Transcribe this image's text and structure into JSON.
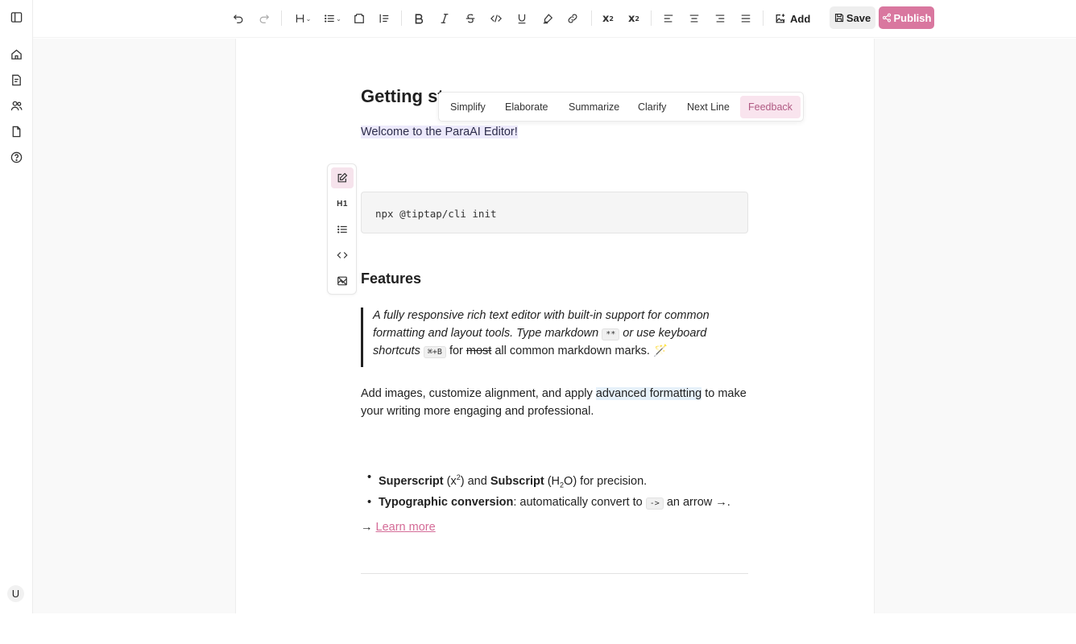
{
  "toolbar": {
    "add_label": "Add",
    "save_label": "Save",
    "publish_label": "Publish",
    "superscript_base": "x",
    "superscript_mark": "2",
    "subscript_base": "x",
    "subscript_mark": "2",
    "colors": {
      "publish_bg": "#d9779f",
      "save_bg": "#eeeeee"
    }
  },
  "rail": {
    "avatar_letter": "U"
  },
  "document": {
    "heading": "Getting st",
    "welcome": "Welcome to the ParaAI Editor!",
    "code": "npx @tiptap/cli init",
    "features_heading": "Features",
    "quote": {
      "part1": "A fully responsive rich text editor with built-in support for common formatting and layout tools. Type markdown ",
      "kbd1": "**",
      "part2": " or use keyboard shortcuts ",
      "kbd2": "⌘+B",
      "part3": " for ",
      "strike": "most",
      "part4": " all common markdown marks. 🪄"
    },
    "paragraph": {
      "before": "Add images, customize alignment, and apply ",
      "highlight": "advanced formatting",
      "after": " to make your writing more engaging and professional."
    },
    "bullets": {
      "b1_bold1": "Superscript",
      "b1_t1": " (x",
      "b1_sup": "2",
      "b1_t2": ") and ",
      "b1_bold2": "Subscript",
      "b1_t3": " (H",
      "b1_sub": "2",
      "b1_t4": "O) for precision.",
      "b2_bold": "Typographic conversion",
      "b2_t1": ": automatically convert to ",
      "b2_kbd": "->",
      "b2_t2": " an arrow →."
    },
    "learn_prefix": "→ ",
    "learn_link": "Learn more"
  },
  "palette": {
    "heading_text": "H1"
  },
  "ai_menu": {
    "items": [
      "Simplify",
      "Elaborate",
      "Summarize",
      "Clarify",
      "Next Line",
      "Feedback"
    ],
    "active": "Feedback"
  }
}
